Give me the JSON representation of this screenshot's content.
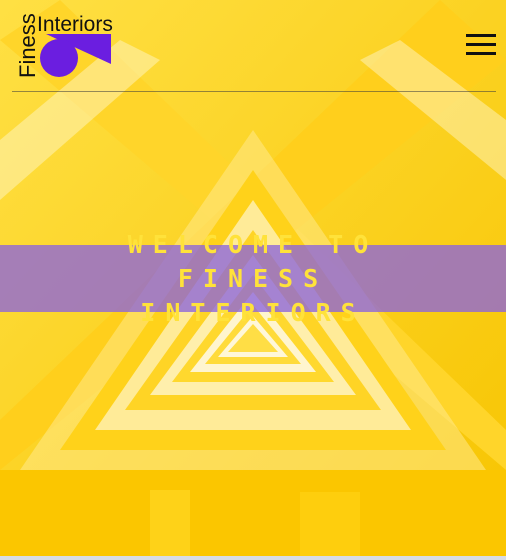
{
  "brand": {
    "word_vertical": "Finess",
    "word_horizontal": "Interiors",
    "accent_purple": "#6b1ee0",
    "accent_yellow": "#ffd21a"
  },
  "nav": {
    "menu_icon": "hamburger-menu-icon"
  },
  "hero": {
    "title": "WELCOME TO FINESS INTERIORS",
    "banner_color": "#8c64dc",
    "title_color": "#ffe23a",
    "background_color": "#ffd21a"
  }
}
